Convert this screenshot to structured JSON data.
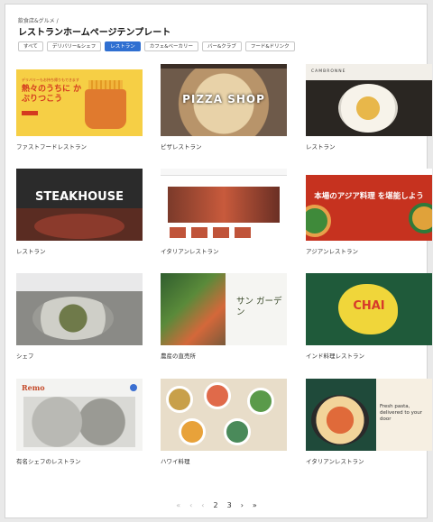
{
  "breadcrumb": "飲食店&グルメ /",
  "title": "レストランホームページテンプレート",
  "filters": [
    {
      "label": "すべて",
      "active": false
    },
    {
      "label": "デリバリー&シェフ",
      "active": false
    },
    {
      "label": "レストラン",
      "active": true
    },
    {
      "label": "カフェ&ベーカリー",
      "active": false
    },
    {
      "label": "バー&クラブ",
      "active": false
    },
    {
      "label": "フード&ドリンク",
      "active": false
    }
  ],
  "templates": [
    {
      "caption": "ファストフードレストラン",
      "thumb": {
        "small": "デリバリーもお持ち帰りもできます",
        "headline": "熱々のうちに かぶりつこう"
      }
    },
    {
      "caption": "ピザレストラン",
      "thumb": {
        "headline": "PIZZA SHOP"
      }
    },
    {
      "caption": "レストラン",
      "thumb": {
        "brand": "CAMBRONNE"
      }
    },
    {
      "caption": "レストラン",
      "thumb": {
        "headline": "STEAKHOUSE"
      }
    },
    {
      "caption": "イタリアンレストラン",
      "thumb": {}
    },
    {
      "caption": "アジアンレストラン",
      "thumb": {
        "headline": "本場のアジア料理 を堪能しよう"
      }
    },
    {
      "caption": "シェフ",
      "thumb": {}
    },
    {
      "caption": "農産の直売所",
      "thumb": {
        "headline": "サン ガーデン"
      }
    },
    {
      "caption": "インド料理レストラン",
      "thumb": {
        "headline": "CHAI"
      }
    },
    {
      "caption": "有名シェフのレストラン",
      "thumb": {
        "brand": "Remo"
      }
    },
    {
      "caption": "ハワイ料理",
      "thumb": {}
    },
    {
      "caption": "イタリアンレストラン",
      "thumb": {
        "headline": "Fresh pasta, delivered to your door"
      }
    }
  ],
  "pagination": {
    "first": "«",
    "prev": "‹",
    "back": "‹",
    "page2": "2",
    "page3": "3",
    "next": "›",
    "last": "»"
  },
  "colors": {
    "accent": "#2f6fd1"
  }
}
